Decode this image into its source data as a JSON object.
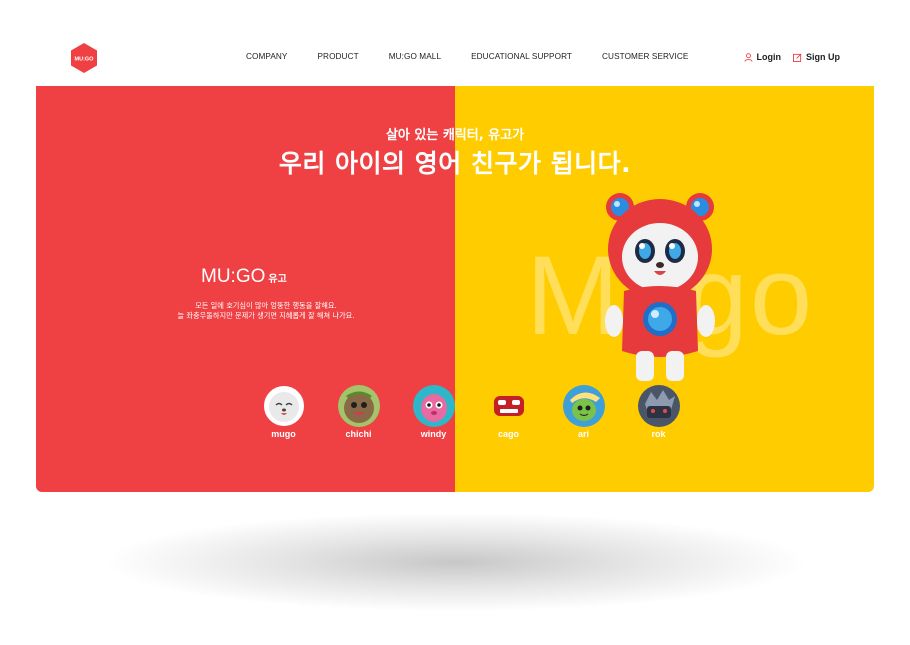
{
  "header": {
    "logo_text": "MU:GO",
    "nav": [
      "COMPANY",
      "PRODUCT",
      "MU:GO MALL",
      "EDUCATIONAL SUPPORT",
      "CUSTOMER SERVICE"
    ],
    "login_label": "Login",
    "signup_label": "Sign Up"
  },
  "hero": {
    "subtitle": "살아 있는 캐릭터, 유고가",
    "title": "우리 아이의 영어 친구가 됩니다.",
    "big_word": "Mugo",
    "brand_name": "MU:GO",
    "brand_name_kr": "유고",
    "brand_desc_line1": "모든 일에 호기심이 많아 엉뚱한 행동을 잘해요.",
    "brand_desc_line2": "늘 좌충우돌하지만 문제가 생기면 지혜롭게 잘 해쳐 나가요."
  },
  "characters": [
    {
      "name": "mugo",
      "color": "#f4f4f4",
      "ring": "#ef4044"
    },
    {
      "name": "chichi",
      "color": "#6a8a46",
      "ring": "#a3c46a"
    },
    {
      "name": "windy",
      "color": "#2fb6c8",
      "ring": "#e8f6f8"
    },
    {
      "name": "cago",
      "color": "#c41f24",
      "ring": "#ffcc00"
    },
    {
      "name": "ari",
      "color": "#3fa0d8",
      "ring": "#ffe27a"
    },
    {
      "name": "rok",
      "color": "#4a5668",
      "ring": "#8e9ab0"
    }
  ],
  "colors": {
    "red": "#ef4044",
    "yellow": "#ffcc00"
  }
}
